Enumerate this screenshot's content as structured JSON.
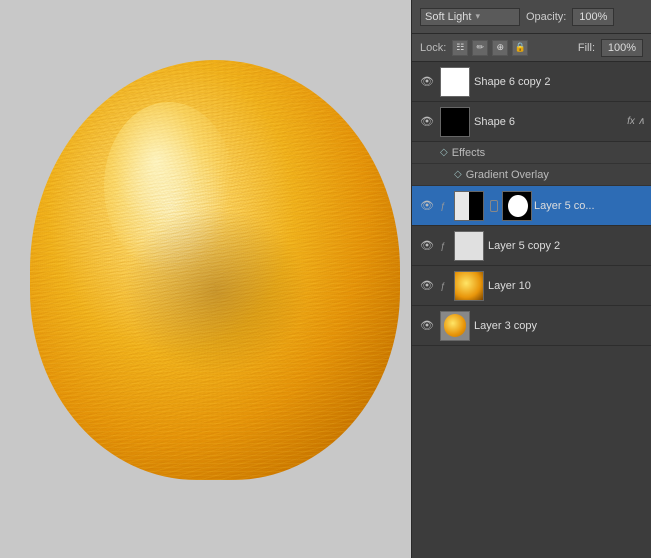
{
  "blend_bar": {
    "blend_mode": "Soft Light",
    "blend_arrow": "▾",
    "opacity_label": "Opacity:",
    "opacity_value": "100%"
  },
  "lock_bar": {
    "lock_label": "Lock:",
    "fill_label": "Fill:",
    "fill_value": "100%",
    "icons": [
      "☷",
      "✏",
      "⊹",
      "🔒"
    ]
  },
  "layers": [
    {
      "id": "shape6copy2",
      "name": "Shape 6 copy 2",
      "visible": true,
      "eye": "●",
      "thumb_type": "white",
      "has_fx": false,
      "selected": false
    },
    {
      "id": "shape6",
      "name": "Shape 6",
      "visible": true,
      "eye": "●",
      "thumb_type": "black-shape",
      "has_fx": true,
      "fx_label": "fx ∧",
      "selected": false
    },
    {
      "id": "effects-group",
      "name": "Effects",
      "is_effects": true
    },
    {
      "id": "gradient-overlay",
      "name": "Gradient Overlay",
      "is_effect": true
    },
    {
      "id": "layer5co",
      "name": "Layer 5 co...",
      "visible": true,
      "eye": "●",
      "thumb_type": "layer5co",
      "has_mask": true,
      "selected": true
    },
    {
      "id": "layer5copy2",
      "name": "Layer 5 copy 2",
      "visible": true,
      "eye": "●",
      "thumb_type": "layer5copy2",
      "has_fx": false,
      "selected": false
    },
    {
      "id": "layer10",
      "name": "Layer 10",
      "visible": true,
      "eye": "●",
      "thumb_type": "layer10",
      "has_fx": false,
      "selected": false
    },
    {
      "id": "layer3copy",
      "name": "Layer 3 copy",
      "visible": true,
      "eye": "●",
      "thumb_type": "layer3copy",
      "has_fx": false,
      "selected": false
    }
  ]
}
